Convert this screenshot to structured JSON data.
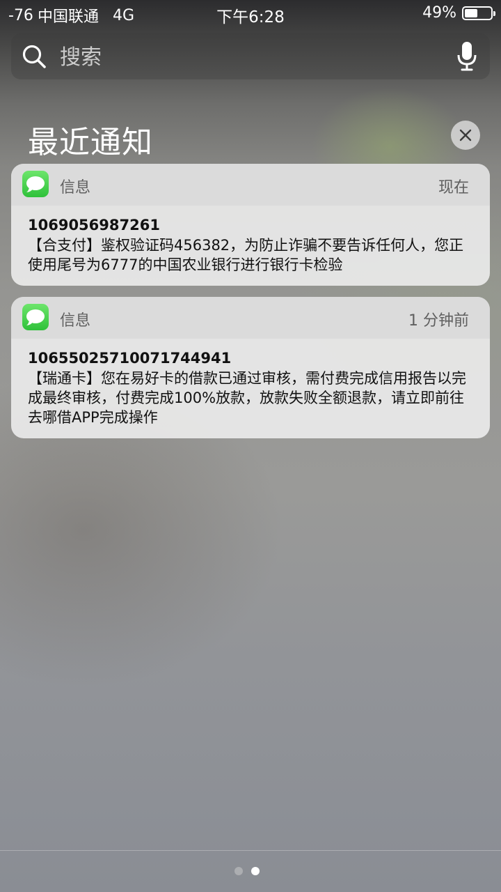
{
  "status_bar": {
    "signal": "-76",
    "carrier": "中国联通",
    "network": "4G",
    "time": "下午6:28",
    "battery_text": "49%",
    "battery_level": 0.49
  },
  "search": {
    "placeholder": "搜索"
  },
  "section": {
    "title": "最近通知"
  },
  "notifications": [
    {
      "app": "信息",
      "time": "现在",
      "sender": "1069056987261",
      "message": "【合支付】鉴权验证码456382，为防止诈骗不要告诉任何人，您正使用尾号为6777的中国农业银行进行银行卡检验"
    },
    {
      "app": "信息",
      "time": "1 分钟前",
      "sender": "10655025710071744941",
      "message": "【瑞通卡】您在易好卡的借款已通过审核，需付费完成信用报告以完成最终审核，付费完成100%放款，放款失败全额退款，请立即前往去哪借APP完成操作"
    }
  ],
  "page_indicator": {
    "count": 2,
    "active": 1
  }
}
